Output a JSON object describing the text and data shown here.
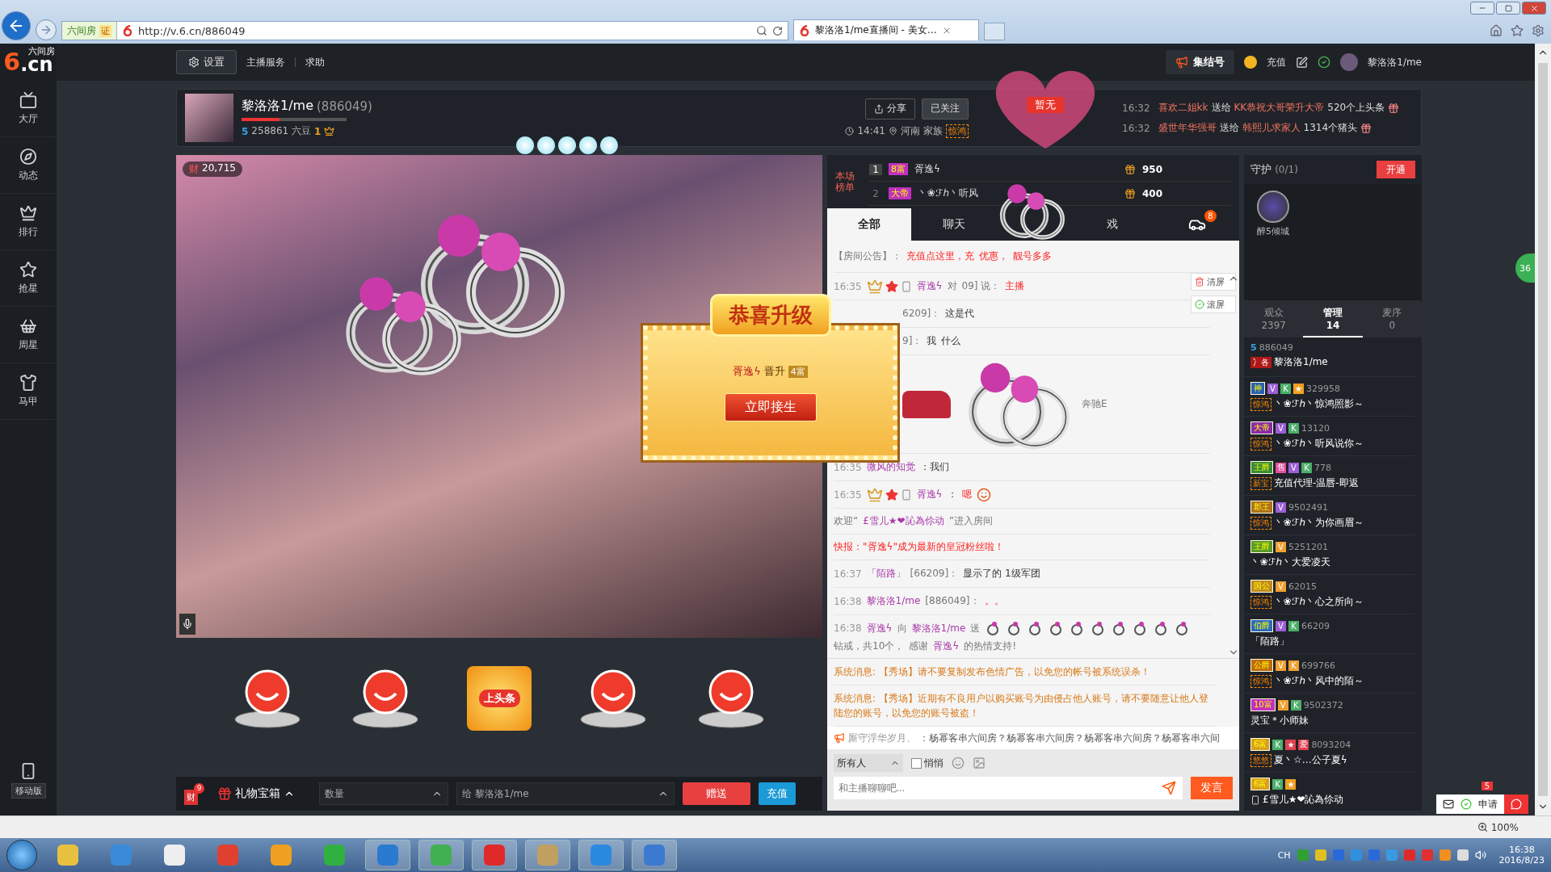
{
  "browser": {
    "address": "http://v.6.cn/886049",
    "site_label": "六间房",
    "cert": "证",
    "tab_title": "黎洛洛1/me直播间 - 美女…",
    "zoom": "100%"
  },
  "site": {
    "logo_mark": "6",
    "logo_text": ".cn",
    "logo_sub": "六间房"
  },
  "nav": [
    {
      "label": "大厅"
    },
    {
      "label": "动态"
    },
    {
      "label": "排行"
    },
    {
      "label": "抢星"
    },
    {
      "label": "周星"
    },
    {
      "label": "马甲"
    }
  ],
  "mobile": "移动版",
  "header": {
    "settings": "设置",
    "links": [
      "主播服务",
      "求助"
    ],
    "rally": "集结号",
    "recharge": "充值",
    "user": "黎洛洛1/me"
  },
  "streamer": {
    "name": "黎洛洛1/me",
    "room": "(886049)",
    "level": 0.36,
    "vip": "5",
    "beans": "258861 六豆",
    "crown": "1",
    "share": "分享",
    "follow": "已关注",
    "flag": "暂无",
    "time": "14:41",
    "place": "河南",
    "family_label": "家族",
    "family": "惊鸿"
  },
  "ticker": [
    {
      "time": "16:32",
      "from": "喜欢二姐kk",
      "verb": "送给",
      "to": "KK恭祝大哥荣升大帝",
      "gift": "520个上头条"
    },
    {
      "time": "16:32",
      "from": "盛世年华强哥",
      "verb": "送给",
      "to": "韩熙儿求家人",
      "gift": "1314个猪头"
    }
  ],
  "video": {
    "wealth": "财",
    "count": "20,715"
  },
  "popup": {
    "title": "恭喜升级",
    "user": "胥逸ϟ",
    "verb": "晋升",
    "rank": "4富",
    "button": "立即接生"
  },
  "gifts": [
    {
      "kind": "face"
    },
    {
      "kind": "face"
    },
    {
      "kind": "headline",
      "label": "上头条"
    },
    {
      "kind": "face"
    },
    {
      "kind": "face"
    }
  ],
  "gift_bar": {
    "wealth": "财",
    "wealth_badge": "9",
    "box": "礼物宝箱",
    "qty_placeholder": "数量",
    "to_label": "给",
    "to": "黎洛洛1/me",
    "give": "赠送",
    "recharge": "充值"
  },
  "ranking": {
    "title": "本场榜单",
    "rows": [
      {
        "rank": "1",
        "badge": "8富",
        "name": "胥逸ϟ",
        "score": "950"
      },
      {
        "rank": "2",
        "badge": "大帝",
        "name": "丶❀ℱℎ丶听风",
        "score": "400"
      }
    ]
  },
  "chat_tabs": [
    {
      "label": "全部",
      "selected": true
    },
    {
      "label": "聊天",
      "selected": false
    },
    {
      "label": "戏",
      "selected": false
    }
  ],
  "car_badge": "8",
  "chat_tools": [
    "清屏",
    "滚屏"
  ],
  "messages": [
    {
      "kind": "notice",
      "segments": [
        {
          "note": "【房间公告】："
        },
        {
          "alert": "充值点这里，充"
        },
        {
          "alert": "优惠，"
        },
        {
          "alert": "靓号多多"
        }
      ]
    },
    {
      "kind": "chat",
      "time": "16:35",
      "badges": true,
      "segments": [
        {
          "name": "胥逸ϟ"
        },
        {
          "note": "对"
        },
        {
          "note": "09] 说："
        },
        {
          "alert": "主播"
        }
      ]
    },
    {
      "kind": "partial",
      "segments": [
        {
          "note": "6209]："
        },
        {
          "text": "这是代"
        }
      ]
    },
    {
      "kind": "partial",
      "segments": [
        {
          "note": "9]："
        },
        {
          "text": "我"
        },
        {
          "text": "什么"
        }
      ]
    },
    {
      "kind": "car",
      "segments": [
        {
          "note": "奔驰E"
        }
      ]
    },
    {
      "kind": "chat",
      "time": "16:35",
      "badges": false,
      "segments": [
        {
          "name": "微风的知觉"
        },
        {
          "text": "：我们"
        }
      ]
    },
    {
      "kind": "chat",
      "time": "16:35",
      "badges": true,
      "segments": [
        {
          "name": "胥逸ϟ"
        },
        {
          "text": "："
        },
        {
          "alert": "嗯"
        }
      ],
      "emoji": true
    },
    {
      "kind": "welcome",
      "segments": [
        {
          "note": "欢迎“"
        },
        {
          "name": "£雪儿★❤訫為伱动"
        },
        {
          "note": "”进入房间"
        }
      ]
    },
    {
      "kind": "flash",
      "segments": [
        {
          "alert": "快报：\"胥逸ϟ\"成为最新的皇冠粉丝啦！"
        }
      ]
    },
    {
      "kind": "chat",
      "time": "16:37",
      "badges": false,
      "segments": [
        {
          "name": "「陌路」"
        },
        {
          "note": "[66209]："
        },
        {
          "text": "显示了的 1级军团"
        }
      ]
    },
    {
      "kind": "chat",
      "time": "16:38",
      "badges": false,
      "segments": [
        {
          "name": "黎洛洛1/me"
        },
        {
          "note": "[886049]："
        },
        {
          "alert": "。。"
        }
      ]
    },
    {
      "kind": "gift",
      "time": "16:38",
      "segments": [
        {
          "name": "胥逸ϟ"
        },
        {
          "note": "向"
        },
        {
          "name": "黎洛洛1/me"
        },
        {
          "note": "送"
        }
      ],
      "after": [
        {
          "note": "钻戒，共10个，"
        },
        {
          "note": "感谢"
        },
        {
          "name": "胥逸ϟ"
        },
        {
          "note": "的热情支持!"
        }
      ]
    }
  ],
  "system": [
    "系统消息: 【秀场】请不要复制发布色情广告，以免您的帐号被系统误杀！",
    "系统消息: 【秀场】近期有不良用户以购买账号为由侵占他人账号，请不要随意让他人登陆您的账号，以免您的账号被盗！"
  ],
  "marquee": {
    "user": "厮守浮华岁月、",
    "text": "：杨幂客串六间房？杨幂客串六间房？杨幂客串六间房？杨幂客串六间"
  },
  "chat_input": {
    "target": "所有人",
    "whisper": "悄悄",
    "whisper_checked": false,
    "placeholder": "和主播聊聊吧...",
    "send": "发言"
  },
  "guard": {
    "title": "守护",
    "count": "(0/1)",
    "button": "开通",
    "members": [
      "醉5倾城"
    ]
  },
  "user_tabs": [
    {
      "label": "观众",
      "count": "2397",
      "selected": false
    },
    {
      "label": "管理",
      "count": "14",
      "selected": true
    },
    {
      "label": "麦序",
      "count": "0",
      "selected": false
    }
  ],
  "users": [
    {
      "kind": "host",
      "vip": "5",
      "id": "886049",
      "tag": "冫各",
      "name": "黎洛洛1/me"
    },
    {
      "kind": "fan",
      "rank": "神",
      "color": "#2a5fb0",
      "tags": [
        {
          "label": "V",
          "color": "#9b5fd6"
        },
        {
          "label": "K",
          "color": "#4caf6a"
        },
        {
          "label": "★",
          "color": "#f0a020"
        }
      ],
      "id": "329958",
      "club": "惊鸿",
      "name": "丶❀ℱℎ丶惊鸿照影～"
    },
    {
      "kind": "fan",
      "rank": "大帝",
      "color": "#8a2aa8",
      "tags": [
        {
          "label": "V",
          "color": "#9b5fd6"
        },
        {
          "label": "K",
          "color": "#4caf6a"
        }
      ],
      "id": "13120",
      "club": "惊鸿",
      "name": "丶❀ℱℎ丶听风说你～"
    },
    {
      "kind": "fan",
      "rank": "王爵",
      "color": "#3a8a3a",
      "tags": [
        {
          "label": "售",
          "color": "#e0509a"
        },
        {
          "label": "V",
          "color": "#9b5fd6"
        },
        {
          "label": "K",
          "color": "#4caf6a"
        }
      ],
      "id": "778",
      "club": "新宝",
      "name": "充值代理-温唇-即返"
    },
    {
      "kind": "fan",
      "rank": "郡王",
      "color": "#b07020",
      "tags": [
        {
          "label": "V",
          "color": "#9b5fd6"
        }
      ],
      "id": "9502491",
      "club": "惊鸿",
      "name": "丶❀ℱℎ丶为你画眉～"
    },
    {
      "kind": "fan",
      "rank": "王爵",
      "color": "#5a9a2a",
      "tags": [
        {
          "label": "V",
          "color": "#f0a030"
        }
      ],
      "id": "5251201",
      "name": "丶❀ℱℎ丶大爱凌天"
    },
    {
      "kind": "fan",
      "rank": "国公",
      "color": "#c08a20",
      "tags": [
        {
          "label": "V",
          "color": "#f0a030"
        }
      ],
      "id": "62015",
      "club": "惊鸿",
      "name": "丶❀ℱℎ丶心之所向～"
    },
    {
      "kind": "fan",
      "rank": "伯爵",
      "color": "#2a6ac0",
      "tags": [
        {
          "label": "V",
          "color": "#9b5fd6"
        },
        {
          "label": "K",
          "color": "#4caf6a"
        }
      ],
      "id": "66209",
      "name": "「陌路」"
    },
    {
      "kind": "fan",
      "rank": "公爵",
      "color": "#c06a10",
      "tags": [
        {
          "label": "V",
          "color": "#f0a030"
        },
        {
          "label": "K",
          "color": "#f0a030"
        }
      ],
      "id": "699766",
      "club": "惊鸿",
      "name": "丶❀ℱℎ丶风中的陌～"
    },
    {
      "kind": "fan",
      "rank": "10富",
      "color": "#c030c0",
      "tags": [
        {
          "label": "V",
          "color": "#f0a030"
        },
        {
          "label": "K",
          "color": "#4caf6a"
        }
      ],
      "id": "9502372",
      "name": "灵宝＊小师妹"
    },
    {
      "kind": "fan",
      "rank": "6富",
      "color": "#d8a020",
      "tags": [
        {
          "label": "K",
          "color": "#4caf6a"
        },
        {
          "label": "★",
          "color": "#e04050"
        },
        {
          "label": "爱",
          "color": "#e04050"
        }
      ],
      "id": "8093204",
      "club": "悠悠",
      "name": "夏丶☆…公子夏ϟ"
    },
    {
      "kind": "fan",
      "rank": "6富",
      "color": "#d8a020",
      "tags": [
        {
          "label": "K",
          "color": "#4caf6a"
        },
        {
          "label": "★",
          "color": "#f0a020"
        }
      ],
      "mobile": true,
      "name": "£雪儿★❤訫為伱动"
    }
  ],
  "float": {
    "apply": "申请",
    "badge": "5",
    "side": "36"
  },
  "taskbar": {
    "input": "CH",
    "time": "16:38",
    "date": "2016/8/23"
  }
}
